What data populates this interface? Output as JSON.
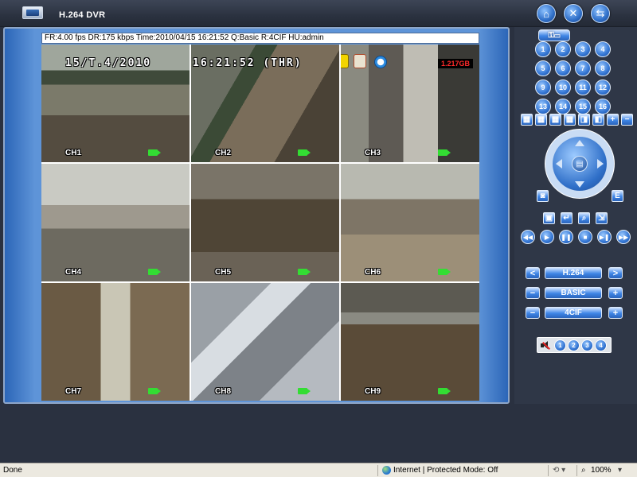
{
  "app": {
    "title": "H.264 DVR"
  },
  "top_buttons": [
    {
      "name": "home-icon",
      "glyph": "⌂"
    },
    {
      "name": "tools-icon",
      "glyph": "✕"
    },
    {
      "name": "network-icon",
      "glyph": "⇆"
    }
  ],
  "osd": {
    "info_text": "FR:4.00 fps  DR:175 kbps Time:2010/04/15 16:21:52 Q:Basic R:4CIF  HU:admin"
  },
  "overlays": {
    "date": "15/T.4/2010",
    "time": "16:21:52 (THR)",
    "disk": "1.217GB"
  },
  "channels": [
    {
      "label": "CH1"
    },
    {
      "label": "CH2"
    },
    {
      "label": "CH3"
    },
    {
      "label": "CH4"
    },
    {
      "label": "CH5"
    },
    {
      "label": "CH6"
    },
    {
      "label": "CH7"
    },
    {
      "label": "CH8"
    },
    {
      "label": "CH9"
    }
  ],
  "panel": {
    "numbers": [
      "1",
      "2",
      "3",
      "4",
      "5",
      "6",
      "7",
      "8",
      "9",
      "10",
      "11",
      "12",
      "13",
      "14",
      "15",
      "16"
    ],
    "ptz_center": "▤",
    "snapshot_label": "◙",
    "e_label": "E",
    "codec": {
      "prev": "<",
      "value": "H.264",
      "next": ">"
    },
    "quality": {
      "minus": "−",
      "value": "BASIC",
      "plus": "+"
    },
    "resolution": {
      "minus": "−",
      "value": "4CIF",
      "plus": "+"
    },
    "audio_channels": [
      "1",
      "2",
      "3",
      "4"
    ],
    "layout_icons": [
      "grid-1-icon",
      "grid-4-icon",
      "grid-9-icon",
      "grid-16-icon",
      "pip-icon",
      "fullscreen-icon",
      "zoom-in-icon",
      "zoom-out-icon"
    ],
    "playback_icons": [
      "rewind-icon",
      "play-icon",
      "pause-icon",
      "stop-icon",
      "step-icon",
      "fast-forward-icon"
    ]
  },
  "statusbar": {
    "left": "Done",
    "zone": "Internet | Protected Mode: Off",
    "zoom": "100%"
  }
}
